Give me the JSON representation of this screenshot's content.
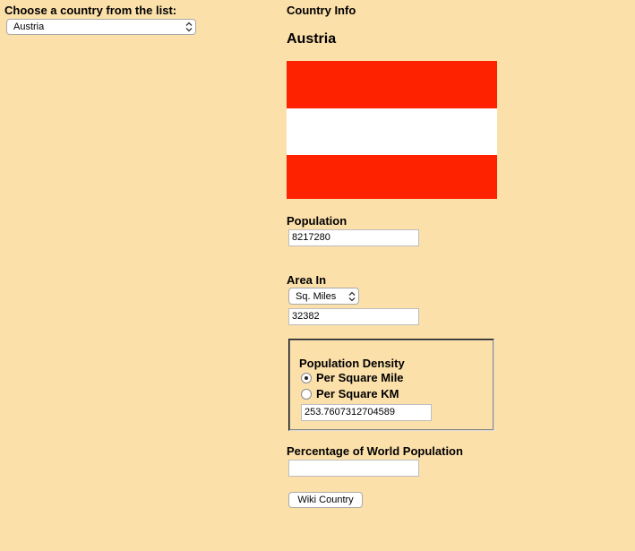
{
  "left": {
    "choose_label": "Choose a country from the list:",
    "country_select_value": "Austria"
  },
  "info": {
    "header": "Country Info",
    "country_name": "Austria",
    "flag": {
      "colors": [
        "#FF2200",
        "#FFFFFF",
        "#FF2200"
      ]
    },
    "population_label": "Population",
    "population_value": "8217280",
    "area_label": "Area In",
    "area_unit_value": "Sq. Miles",
    "area_value": "32382",
    "density": {
      "label": "Population Density",
      "options": [
        {
          "label": "Per Square Mile",
          "checked": true
        },
        {
          "label": "Per Square KM",
          "checked": false
        }
      ],
      "value": "253.7607312704589"
    },
    "world_pct_label": "Percentage of World Population",
    "world_pct_value": "",
    "wiki_button": "Wiki Country"
  },
  "colors": {
    "background": "#FCE0AA",
    "flag_red": "#FF2200"
  }
}
